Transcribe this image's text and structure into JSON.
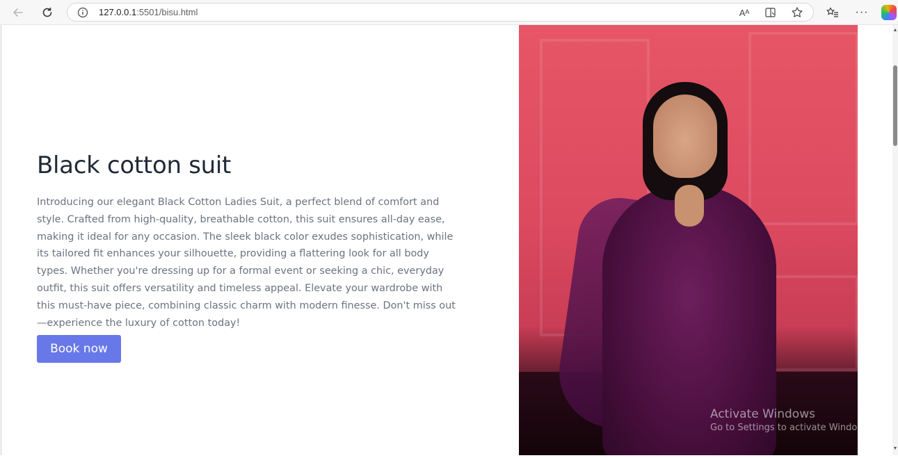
{
  "browser": {
    "url_host": "127.0.0.1",
    "url_rest": ":5501/bisu.html",
    "icons": [
      "back-arrow-icon",
      "refresh-icon",
      "info-icon",
      "read-aloud-icon",
      "immersive-reader-icon",
      "favorite-star-icon",
      "favorites-list-icon",
      "more-options-icon",
      "copilot-icon"
    ],
    "read_aloud_label": "Aᴬ"
  },
  "hero": {
    "title": "Black cotton suit",
    "description": "Introducing our elegant Black Cotton Ladies Suit, a perfect blend of comfort and style. Crafted from high-quality, breathable cotton, this suit ensures all-day ease, making it ideal for any occasion. The sleek black color exudes sophistication, while its tailored fit enhances your silhouette, providing a flattering look for all body types. Whether you're dressing up for a formal event or seeking a chic, everyday outfit, this suit offers versatility and timeless appeal. Elevate your wardrobe with this must-have piece, combining classic charm with modern finesse. Don't miss out—experience the luxury of cotton today!",
    "button_label": "Book now",
    "image_alt": "Woman in purple embroidered suit against pink wall"
  },
  "watermark": {
    "line1": "Activate Windows",
    "line2": "Go to Settings to activate Windows."
  },
  "colors": {
    "accent_button": "#6878e8",
    "title": "#1f2937",
    "body_text": "#6b7280",
    "photo_wall": "#e65666"
  }
}
